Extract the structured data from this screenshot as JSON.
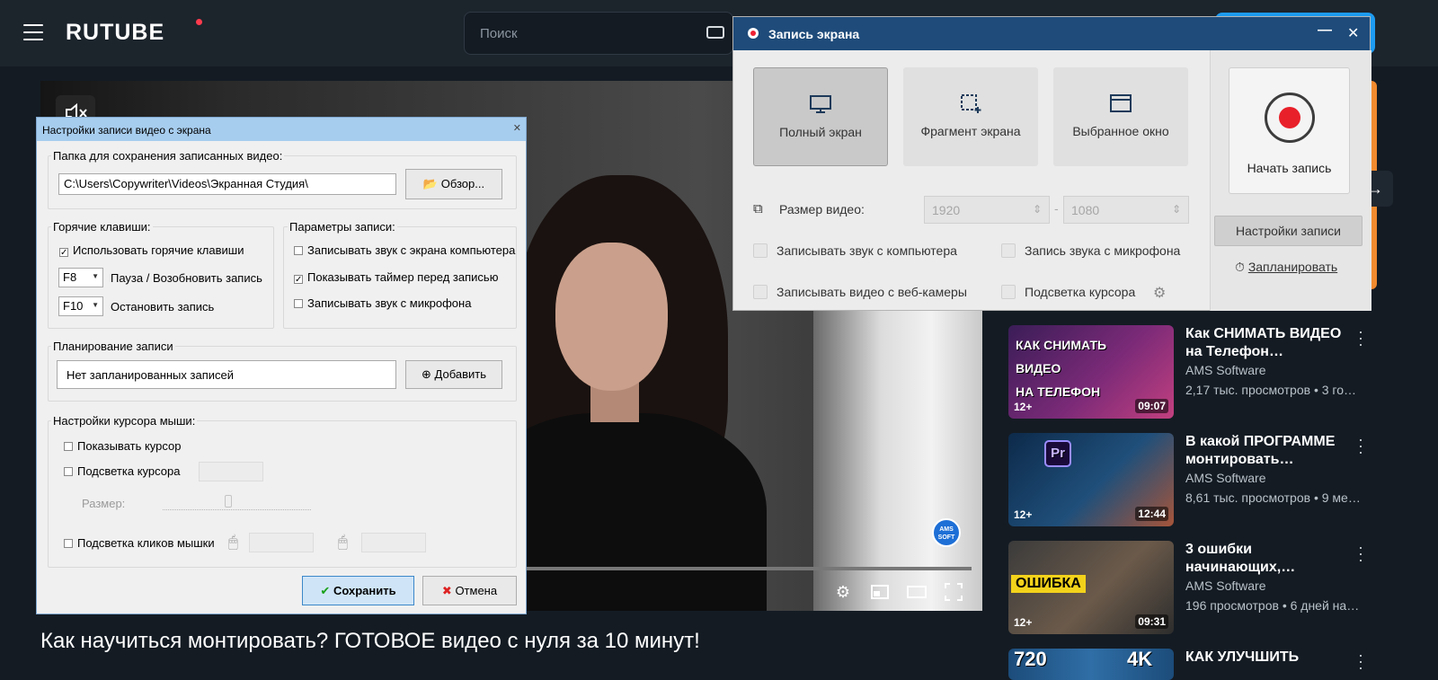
{
  "header": {
    "logo": "RUTUBE",
    "search_placeholder": "Поиск"
  },
  "video": {
    "title": "Как научиться монтировать? ГОТОВОЕ видео с нуля за 10 минут!",
    "badge": "AMS SOFT"
  },
  "recommendations": [
    {
      "title": "Как СНИМАТЬ ВИДЕО на Телефон…",
      "channel": "AMS Software",
      "meta": "2,17 тыс. просмотров • 3 го…",
      "age": "12+",
      "duration": "09:07",
      "thumb_text": [
        "КАК СНИМАТЬ",
        "ВИДЕО",
        "НА ТЕЛЕФОН"
      ]
    },
    {
      "title": "В какой ПРОГРАММЕ монтировать…",
      "channel": "AMS Software",
      "meta": "8,61 тыс. просмотров • 9 ме…",
      "age": "12+",
      "duration": "12:44",
      "thumb_text": [
        "Pr"
      ]
    },
    {
      "title": "3 ошибки начинающих,…",
      "channel": "AMS Software",
      "meta": "196 просмотров • 6 дней на…",
      "age": "12+",
      "duration": "09:31",
      "thumb_text": [
        "ОШИБКА"
      ]
    },
    {
      "title": "КАК УЛУЧШИТЬ",
      "thumb_text": [
        "720",
        "4K"
      ]
    }
  ],
  "settings_dialog": {
    "title": "Настройки записи видео с экрана",
    "folder_group": "Папка для сохранения записанных видео:",
    "folder_path": "C:\\Users\\Copywriter\\Videos\\Экранная Студия\\",
    "browse_label": "Обзор...",
    "hotkeys_group": "Горячие клавиши:",
    "use_hotkeys": "Использовать горячие клавиши",
    "pause_key": "F8",
    "pause_label": "Пауза / Возобновить запись",
    "stop_key": "F10",
    "stop_label": "Остановить запись",
    "params_group": "Параметры записи:",
    "rec_screen_sound": "Записывать звук с экрана компьютера",
    "show_timer": "Показывать таймер перед записью",
    "rec_mic": "Записывать звук с микрофона",
    "schedule_group": "Планирование записи",
    "schedule_value": "Нет запланированных записей",
    "add_label": "Добавить",
    "cursor_group": "Настройки курсора мыши:",
    "show_cursor": "Показывать курсор",
    "highlight_cursor": "Подсветка курсора",
    "size_label": "Размер:",
    "highlight_clicks": "Подсветка кликов мышки",
    "save_label": "Сохранить",
    "cancel_label": "Отмена"
  },
  "recorder": {
    "title": "Запись экрана",
    "modes": [
      "Полный экран",
      "Фрагмент экрана",
      "Выбранное окно"
    ],
    "size_label": "Размер видео:",
    "width": "1920",
    "height": "1080",
    "chk_computer_sound": "Записывать звук с компьютера",
    "chk_mic": "Запись звука с микрофона",
    "chk_webcam": "Записывать видео с веб-камеры",
    "chk_cursor": "Подсветка курсора",
    "start_label": "Начать запись",
    "settings_label": "Настройки записи",
    "schedule_label": "Запланировать"
  },
  "colors": {
    "accent": "#1d9bf0",
    "rec_red": "#e8202a",
    "titlebar": "#1e4b7a"
  }
}
